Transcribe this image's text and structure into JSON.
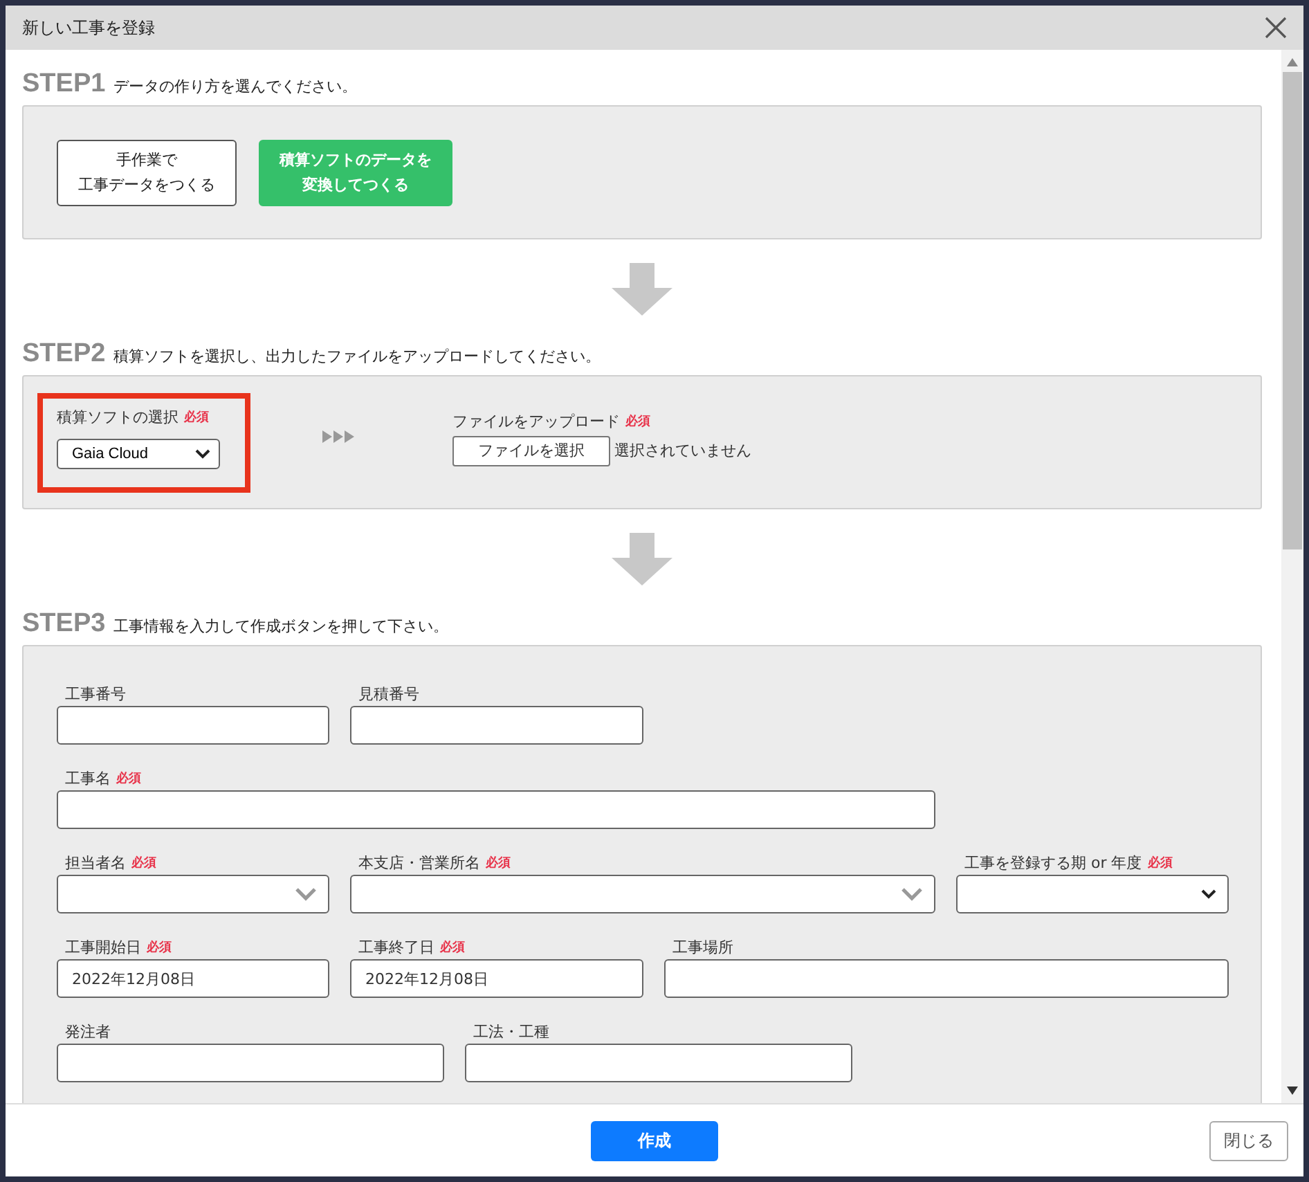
{
  "dialog": {
    "title": "新しい工事を登録"
  },
  "step1": {
    "label": "STEP1",
    "instruction": "データの作り方を選んでください。",
    "options": [
      {
        "lines": [
          "手作業で",
          "工事データをつくる"
        ],
        "selected": false
      },
      {
        "lines": [
          "積算ソフトのデータを",
          "変換してつくる"
        ],
        "selected": true
      }
    ]
  },
  "step2": {
    "label": "STEP2",
    "instruction": "積算ソフトを選択し、出力したファイルをアップロードしてください。",
    "software": {
      "label": "積算ソフトの選択",
      "required": "必須",
      "value": "Gaia Cloud",
      "highlighted": true
    },
    "upload": {
      "label": "ファイルをアップロード",
      "required": "必須",
      "button": "ファイルを選択",
      "status": "選択されていません"
    }
  },
  "step3": {
    "label": "STEP3",
    "instruction": "工事情報を入力して作成ボタンを押して下さい。",
    "rows": [
      [
        {
          "label": "工事番号",
          "kind": "text"
        },
        {
          "label": "見積番号",
          "kind": "text"
        }
      ],
      [
        {
          "label": "工事名",
          "required": "必須",
          "kind": "text"
        }
      ],
      [
        {
          "label": "担当者名",
          "required": "必須",
          "kind": "combo"
        },
        {
          "label": "本支店・営業所名",
          "required": "必須",
          "kind": "combo"
        },
        {
          "label": "工事を登録する期 or 年度",
          "required": "必須",
          "kind": "select"
        }
      ],
      [
        {
          "label": "工事開始日",
          "required": "必須",
          "kind": "text",
          "value": "2022年12月08日"
        },
        {
          "label": "工事終了日",
          "required": "必須",
          "kind": "text",
          "value": "2022年12月08日"
        },
        {
          "label": "工事場所",
          "kind": "text"
        }
      ],
      [
        {
          "label": "発注者",
          "kind": "text"
        },
        {
          "label": "工法・工種",
          "kind": "text"
        }
      ]
    ]
  },
  "footer": {
    "primary": "作成",
    "close": "閉じる"
  }
}
